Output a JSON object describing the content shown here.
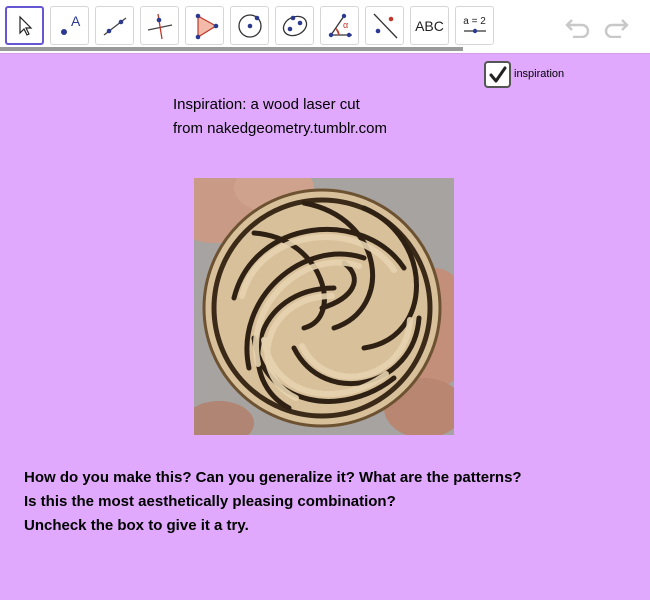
{
  "toolbar": {
    "tools": [
      {
        "name": "move-tool",
        "icon": "arrow-pointer-icon"
      },
      {
        "name": "point-tool",
        "icon": "point-icon",
        "label": "A"
      },
      {
        "name": "line-tool",
        "icon": "line-icon"
      },
      {
        "name": "perpendicular-line-tool",
        "icon": "perpendicular-line-icon"
      },
      {
        "name": "polygon-tool",
        "icon": "polygon-icon"
      },
      {
        "name": "circle-tool",
        "icon": "circle-center-point-icon"
      },
      {
        "name": "ellipse-tool",
        "icon": "ellipse-icon"
      },
      {
        "name": "angle-tool",
        "icon": "angle-icon",
        "label": "α"
      },
      {
        "name": "reflect-tool",
        "icon": "reflect-icon"
      },
      {
        "name": "text-tool",
        "icon": "text-icon",
        "label": "ABC"
      },
      {
        "name": "slider-tool",
        "icon": "slider-icon",
        "label": "a = 2"
      }
    ],
    "undo_icon": "undo-icon",
    "redo_icon": "redo-icon",
    "accent_color": "#6557d2"
  },
  "canvas": {
    "background": "#e1a9fd",
    "checkbox": {
      "label": "inspiration",
      "checked": true
    },
    "inspiration_lines": [
      "Inspiration: a wood laser cut",
      "from nakedgeometry.tumblr.com"
    ],
    "question_lines": [
      "How do you make this? Can you generalize it? What are the patterns?",
      "Is this the most aesthetically pleasing combination?",
      "Uncheck the box to give it a try."
    ],
    "photo": {
      "icon": "wooden-knot-coaster-image"
    }
  }
}
